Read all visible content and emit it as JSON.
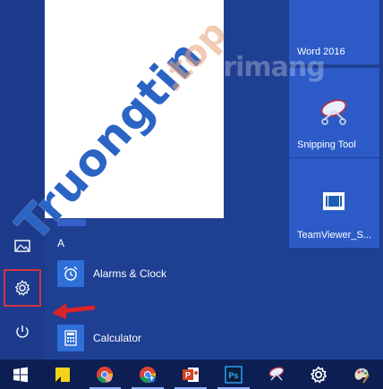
{
  "start_menu": {
    "list": {
      "section_letter": "A",
      "apps": [
        {
          "label": "Alarms & Clock",
          "icon": "alarm-clock-icon"
        },
        {
          "label": "Calculator",
          "icon": "calculator-icon"
        }
      ]
    },
    "left_rail": [
      {
        "name": "pictures",
        "icon": "pictures-icon"
      },
      {
        "name": "settings",
        "icon": "gear-icon",
        "selected": true
      },
      {
        "name": "power",
        "icon": "power-icon"
      }
    ],
    "tiles": [
      {
        "label": "Word 2016",
        "icon": "word-icon"
      },
      {
        "label": "Snipping Tool",
        "icon": "snipping-tool-icon"
      },
      {
        "label": "TeamViewer_S...",
        "icon": "teamviewer-icon"
      }
    ]
  },
  "taskbar": {
    "items": [
      {
        "name": "start",
        "icon": "windows-logo-icon"
      },
      {
        "name": "sticky-notes",
        "icon": "sticky-notes-icon"
      },
      {
        "name": "chrome",
        "icon": "chrome-icon"
      },
      {
        "name": "chrome-update",
        "icon": "chrome-update-icon"
      },
      {
        "name": "powerpoint",
        "icon": "powerpoint-icon"
      },
      {
        "name": "photoshop",
        "icon": "photoshop-icon",
        "text": "Ps"
      },
      {
        "name": "snipping-tool",
        "icon": "snipping-tool-icon"
      },
      {
        "name": "settings",
        "icon": "gear-icon"
      },
      {
        "name": "paint",
        "icon": "paint-icon"
      }
    ]
  },
  "watermark": {
    "main": "Truongtin",
    "suffix": ".top",
    "secondary": "trimang"
  },
  "colors": {
    "background": "#1f3f93",
    "tile": "#2c5bc8",
    "app_icon": "#2f6fd8",
    "taskbar": "#0d1f52",
    "highlight": "#cf3540",
    "arrow": "#d8232a"
  }
}
